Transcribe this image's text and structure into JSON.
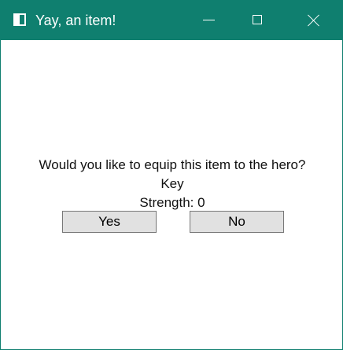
{
  "window": {
    "title": "Yay, an item!"
  },
  "dialog": {
    "question": "Would you like to equip this item to the hero?",
    "item_name": "Key",
    "strength_text": "Strength: 0",
    "yes_label": "Yes",
    "no_label": "No"
  },
  "icons": {
    "app": "window-app-icon",
    "minimize": "minimize-icon",
    "maximize": "maximize-icon",
    "close": "close-icon"
  },
  "colors": {
    "titlebar": "#0f7f6f",
    "button_fill": "#e1e1e1",
    "button_border": "#777777"
  }
}
